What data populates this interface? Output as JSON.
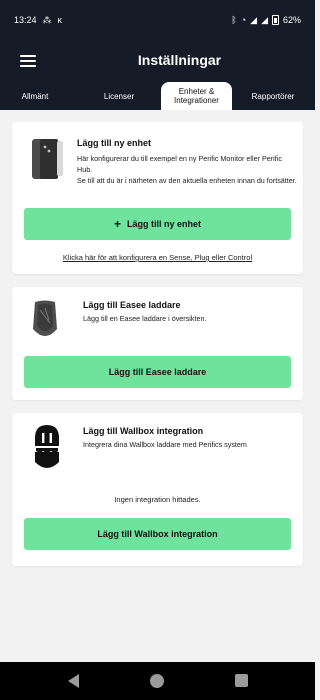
{
  "status_bar": {
    "time": "13:24",
    "app_icons": [
      "network-icon",
      "k-icon"
    ],
    "battery": "62%"
  },
  "app_bar": {
    "title": "Inställningar",
    "menu_icon": "hamburger-icon"
  },
  "tabs": [
    {
      "label": "Allmänt",
      "active": false
    },
    {
      "label": "Licenser",
      "active": false
    },
    {
      "label": "Enheter & Integrationer",
      "active": true
    },
    {
      "label": "Rapportörer",
      "active": false
    }
  ],
  "cards": {
    "new_device": {
      "title": "Lägg till ny enhet",
      "description_1": "Här konfigurerar du till exempel en ny Perific Monitor eller Perific Hub.",
      "description_2": "Se till att du är i närheten av den aktuella enheten innan du fortsätter.",
      "button_label": "Lägg till ny enhet",
      "link": "Klicka här för att konfigurera en Sense, Plug eller Control"
    },
    "easee": {
      "title": "Lägg till Easee laddare",
      "description": "Lägg till en Easee laddare i översikten.",
      "button_label": "Lägg till Easee laddare"
    },
    "wallbox": {
      "title": "Lägg till Wallbox integration",
      "description": "Integrera dina Wallbox laddare med Perifics system",
      "status": "Ingen integration hittades.",
      "button_label": "Lägg till Wallbox integration"
    }
  },
  "colors": {
    "header": "#161b28",
    "button": "#6fe29e",
    "background": "#f2f2f2"
  }
}
